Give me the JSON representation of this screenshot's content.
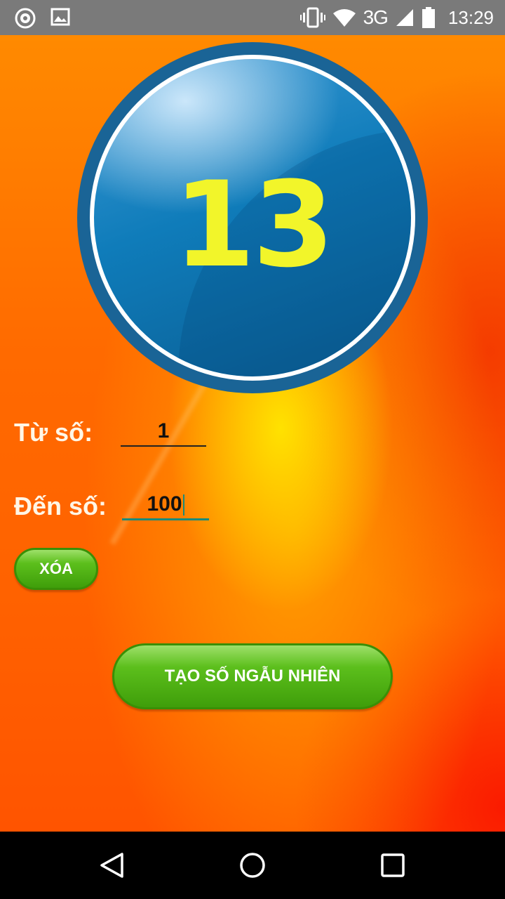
{
  "status_bar": {
    "time": "13:29",
    "network": "3G",
    "icons": [
      "compass-icon",
      "image-icon",
      "vibrate-icon",
      "wifi-icon",
      "signal-icon",
      "battery-icon"
    ]
  },
  "display": {
    "number": "13"
  },
  "form": {
    "from_label": "Từ số:",
    "from_value": "1",
    "to_label": "Đến số:",
    "to_value": "100"
  },
  "buttons": {
    "clear_label": "XÓA",
    "generate_label": "TẠO SỐ NGẪU NHIÊN"
  },
  "colors": {
    "number": "#f2f52a",
    "circle": "#1a6496",
    "button": "#5cbf1c",
    "background": "#ff6a00"
  },
  "nav_bar": {
    "icons": [
      "back-icon",
      "home-icon",
      "recents-icon"
    ]
  }
}
